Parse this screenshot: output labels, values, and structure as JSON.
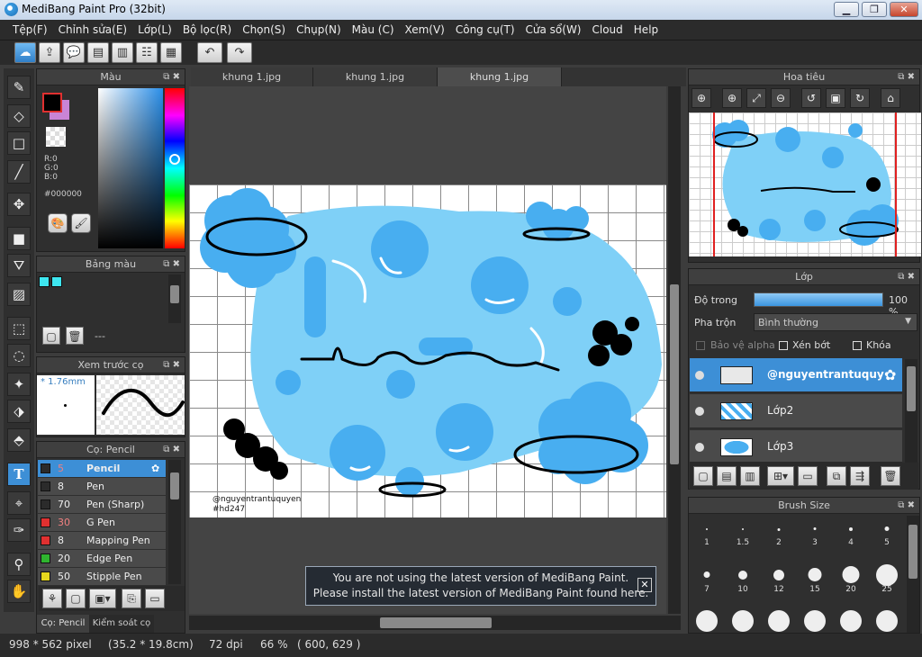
{
  "window": {
    "title": "MediBang Paint Pro (32bit)",
    "minimize": "▁",
    "maximize": "❐",
    "close": "✕"
  },
  "menu": [
    "Tệp(F)",
    "Chỉnh sửa(E)",
    "Lớp(L)",
    "Bộ lọc(R)",
    "Chọn(S)",
    "Chụp(N)",
    "Màu (C)",
    "Xem(V)",
    "Công cụ(T)",
    "Cửa sổ(W)",
    "Cloud",
    "Help"
  ],
  "toolbar": {
    "cloud": "☁",
    "export": "⇪",
    "comment": "💬",
    "note": "▤",
    "page": "▥",
    "list": "☷",
    "grid": "▦",
    "undo": "↶",
    "redo": "↷"
  },
  "tools": {
    "brush": "✎",
    "eraser": "◇",
    "rect": "□",
    "pen": "╱",
    "move": "✥",
    "fill": "■",
    "bucket": "⛛",
    "gradient": "▨",
    "select": "⬚",
    "lasso": "◌",
    "wand": "✦",
    "selpen": "⬗",
    "selerase": "⬘",
    "text": "T",
    "operation": "⌖",
    "divide": "✑",
    "eyedrop": "⚲",
    "hand": "✋"
  },
  "color_panel": {
    "title": "Màu",
    "r": "R:0",
    "g": "G:0",
    "b": "B:0",
    "hex": "#000000",
    "fg": "#000000",
    "bg": "#c984d6",
    "pal_icon": "🎨",
    "pal2_icon": "🖌"
  },
  "palette_panel": {
    "title": "Bảng màu",
    "swatches": [
      "#3ee6f0",
      "#3ee6f0"
    ],
    "dash": "---",
    "new_icon": "▢",
    "trash_icon": "🗑"
  },
  "preview_panel": {
    "title": "Xem trước cọ",
    "size": "* 1.76mm"
  },
  "brush_panel": {
    "title": "Cọ: Pencil",
    "gear": "✿",
    "items": [
      {
        "size": "5",
        "name": "Pencil",
        "color": "#2b2b2b"
      },
      {
        "size": "8",
        "name": "Pen",
        "color": "#2b2b2b"
      },
      {
        "size": "70",
        "name": "Pen (Sharp)",
        "color": "#2b2b2b"
      },
      {
        "size": "30",
        "name": "G Pen",
        "color": "#e03030"
      },
      {
        "size": "8",
        "name": "Mapping Pen",
        "color": "#e03030"
      },
      {
        "size": "20",
        "name": "Edge Pen",
        "color": "#2fb52f"
      },
      {
        "size": "50",
        "name": "Stipple Pen",
        "color": "#e6d81e"
      }
    ],
    "tab1": "Cọ: Pencil",
    "tab2": "Kiểm soát cọ",
    "bottom_icons": [
      "⚘",
      "▢",
      "▣▾",
      "⎘",
      "▭"
    ]
  },
  "tabs": [
    "khung 1.jpg",
    "khung 1.jpg",
    "khung 1.jpg"
  ],
  "canvas": {
    "signature1": "@nguyentrantuquyen",
    "signature2": "#hd247",
    "notice_line1": "You are not using the latest version of MediBang Paint.",
    "notice_line2": "Please install the latest version of MediBang Paint found here.",
    "notice_close": "✕"
  },
  "navigator": {
    "title": "Hoa tiêu",
    "buttons": [
      "⊕",
      "⊕",
      "⤢",
      "⊖",
      "↺",
      "▣",
      "↻",
      "⌂"
    ]
  },
  "layers": {
    "title": "Lớp",
    "opacity_label": "Độ trong",
    "opacity_value": "100 %",
    "opacity_fraction": 1.0,
    "blend_label": "Pha trộn",
    "blend_value": "Bình thường",
    "protect_alpha": "Bảo vệ alpha",
    "clip": "Xén bớt",
    "lock": "Khóa",
    "items": [
      {
        "name": "@nguyentrantuquye",
        "selected": true
      },
      {
        "name": "Lớp2",
        "selected": false
      },
      {
        "name": "Lớp3",
        "selected": false
      }
    ],
    "bottom_icons": [
      "▢",
      "▤",
      "▥",
      "⊞▾",
      "▭",
      "⧉",
      "⇶",
      "🗑"
    ]
  },
  "brush_size": {
    "title": "Brush Size",
    "sizes": [
      "1",
      "1.5",
      "2",
      "3",
      "4",
      "5",
      "7",
      "10",
      "12",
      "15",
      "20",
      "25",
      "",
      "",
      "",
      "",
      "",
      ""
    ]
  },
  "status": {
    "dims": "998 * 562 pixel",
    "cm": "(35.2 * 19.8cm)",
    "dpi": "72 dpi",
    "zoom": "66 %",
    "coords": "( 600, 629 )"
  }
}
